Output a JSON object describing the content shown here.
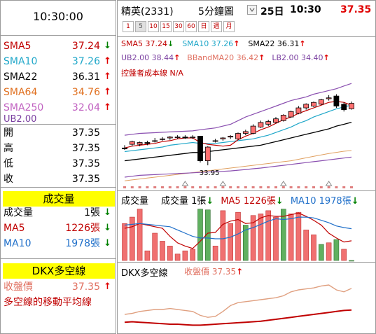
{
  "header": {
    "time": "10:30:00",
    "stock_name": "精英(2331)",
    "interval": "5分鐘圖",
    "date": "25日",
    "clock": "10:30",
    "price": "37.35",
    "timeframes": [
      "1",
      "5",
      "10",
      "15",
      "30",
      "60",
      "日",
      "週",
      "月"
    ],
    "selected_timeframe": "5"
  },
  "sidebar": {
    "ma_rows": [
      {
        "label": "SMA5",
        "value": "37.24",
        "dir": "down",
        "color": "#c00000"
      },
      {
        "label": "SMA10",
        "value": "37.26",
        "dir": "up",
        "color": "#1fa7c9"
      },
      {
        "label": "SMA22",
        "value": "36.31",
        "dir": "up",
        "color": "#000000"
      },
      {
        "label": "SMA64",
        "value": "34.76",
        "dir": "up",
        "color": "#e07020"
      },
      {
        "label": "SMA250",
        "value": "32.04",
        "dir": "up",
        "color": "#c060c0"
      }
    ],
    "ub_label": "UB2.00",
    "quote_rows": [
      {
        "label": "開",
        "value": "37.35"
      },
      {
        "label": "高",
        "value": "37.35"
      },
      {
        "label": "低",
        "value": "37.35"
      },
      {
        "label": "收",
        "value": "37.35"
      }
    ],
    "volume_title": "成交量",
    "volume_rows": [
      {
        "label": "成交量",
        "value": "1張",
        "dir": "down",
        "color": "#000000"
      },
      {
        "label": "MA5",
        "value": "1226張",
        "dir": "down",
        "color": "#c00000"
      },
      {
        "label": "MA10",
        "value": "1978張",
        "dir": "down",
        "color": "#1f6fc9"
      }
    ],
    "dkx_title": "DKX多空線",
    "dkx_rows": [
      {
        "label": "收盤價",
        "value": "37.35",
        "dir": "up",
        "color": "#e07060"
      },
      {
        "label": "多空線的移動平均線",
        "value": "",
        "dir": "",
        "color": "#c00000"
      }
    ]
  },
  "main_chart": {
    "legend_line1": [
      {
        "text": "SMA5 37.24",
        "dir": "down",
        "color": "#c00000"
      },
      {
        "text": "SMA10 37.26",
        "dir": "up",
        "color": "#1fa7c9"
      },
      {
        "text": "SMA22 36.31",
        "dir": "up",
        "color": "#000000"
      }
    ],
    "legend_line2": [
      {
        "text": "UB2.00 38.44",
        "dir": "up",
        "color": "#7a3fa0"
      },
      {
        "text": "BBandMA20 36.42",
        "dir": "up",
        "color": "#e07060"
      },
      {
        "text": "LB2.00 34.40",
        "dir": "up",
        "color": "#7a3fa0"
      }
    ],
    "cost_line": "控盤者成本線 N/A",
    "low_marker": "33.95"
  },
  "volume_panel": {
    "title": "成交量",
    "legend": [
      {
        "text": "成交量 1張",
        "dir": "down",
        "color": "#000000"
      },
      {
        "text": "MA5 1226張",
        "dir": "down",
        "color": "#c00000"
      },
      {
        "text": "MA10 1978張",
        "dir": "down",
        "color": "#1f6fc9"
      }
    ]
  },
  "dkx_panel": {
    "title": "DKX多空線",
    "legend": [
      {
        "text": "收盤價 37.35",
        "dir": "up",
        "color": "#e07060"
      }
    ]
  },
  "chart_data": {
    "type": "candlestick",
    "candles": [
      {
        "o": 34.9,
        "h": 35.05,
        "l": 34.8,
        "c": 34.85
      },
      {
        "o": 35.1,
        "h": 35.3,
        "l": 35.0,
        "c": 35.25
      },
      {
        "o": 35.1,
        "h": 35.25,
        "l": 35.0,
        "c": 35.2
      },
      {
        "o": 35.2,
        "h": 35.3,
        "l": 35.05,
        "c": 35.15
      },
      {
        "o": 35.3,
        "h": 35.45,
        "l": 35.2,
        "c": 35.3
      },
      {
        "o": 35.4,
        "h": 35.5,
        "l": 35.3,
        "c": 35.4
      },
      {
        "o": 35.45,
        "h": 35.55,
        "l": 35.35,
        "c": 35.5
      },
      {
        "o": 35.5,
        "h": 35.6,
        "l": 35.4,
        "c": 35.5
      },
      {
        "o": 35.5,
        "h": 35.6,
        "l": 35.4,
        "c": 35.45
      },
      {
        "o": 35.5,
        "h": 35.6,
        "l": 35.4,
        "c": 35.5
      },
      {
        "o": 35.55,
        "h": 35.55,
        "l": 34.1,
        "c": 34.2
      },
      {
        "o": 34.2,
        "h": 35.0,
        "l": 33.95,
        "c": 34.95
      },
      {
        "o": 35.3,
        "h": 35.4,
        "l": 35.2,
        "c": 35.3
      },
      {
        "o": 35.4,
        "h": 35.5,
        "l": 35.3,
        "c": 35.45
      },
      {
        "o": 35.5,
        "h": 35.6,
        "l": 35.4,
        "c": 35.55
      },
      {
        "o": 35.4,
        "h": 35.75,
        "l": 35.35,
        "c": 35.7
      },
      {
        "o": 35.7,
        "h": 35.9,
        "l": 35.6,
        "c": 35.8
      },
      {
        "o": 35.7,
        "h": 36.2,
        "l": 35.65,
        "c": 36.1
      },
      {
        "o": 36.05,
        "h": 36.4,
        "l": 36.0,
        "c": 36.3
      },
      {
        "o": 36.2,
        "h": 36.45,
        "l": 36.1,
        "c": 36.35
      },
      {
        "o": 36.3,
        "h": 36.6,
        "l": 36.25,
        "c": 36.5
      },
      {
        "o": 36.4,
        "h": 36.75,
        "l": 36.35,
        "c": 36.7
      },
      {
        "o": 36.6,
        "h": 36.95,
        "l": 36.55,
        "c": 36.9
      },
      {
        "o": 36.8,
        "h": 37.2,
        "l": 36.75,
        "c": 37.1
      },
      {
        "o": 37.1,
        "h": 37.35,
        "l": 37.0,
        "c": 37.3
      },
      {
        "o": 37.2,
        "h": 37.45,
        "l": 37.15,
        "c": 37.4
      },
      {
        "o": 37.3,
        "h": 37.6,
        "l": 37.25,
        "c": 37.55
      },
      {
        "o": 37.6,
        "h": 37.8,
        "l": 37.5,
        "c": 37.65
      },
      {
        "o": 37.75,
        "h": 37.85,
        "l": 37.1,
        "c": 37.2
      },
      {
        "o": 37.3,
        "h": 37.4,
        "l": 36.9,
        "c": 37.0
      },
      {
        "o": 37.05,
        "h": 37.45,
        "l": 37.0,
        "c": 37.35
      }
    ],
    "ma5": [
      34.9,
      35.0,
      35.05,
      35.1,
      35.15,
      35.25,
      35.3,
      35.4,
      35.45,
      35.45,
      35.2,
      35.1,
      35.05,
      35.0,
      35.05,
      35.35,
      35.55,
      35.7,
      35.9,
      36.05,
      36.25,
      36.45,
      36.6,
      36.8,
      36.95,
      37.1,
      37.25,
      37.4,
      37.45,
      37.4,
      37.24
    ],
    "ma10": [
      34.7,
      34.75,
      34.8,
      34.85,
      34.9,
      34.95,
      35.05,
      35.1,
      35.15,
      35.2,
      35.15,
      35.15,
      35.15,
      35.2,
      35.25,
      35.3,
      35.35,
      35.4,
      35.5,
      35.6,
      35.75,
      35.9,
      36.05,
      36.25,
      36.4,
      36.6,
      36.75,
      36.9,
      37.05,
      37.15,
      37.26
    ],
    "ma22": [
      34.2,
      34.25,
      34.3,
      34.35,
      34.4,
      34.45,
      34.5,
      34.55,
      34.6,
      34.65,
      34.65,
      34.7,
      34.75,
      34.8,
      34.85,
      34.9,
      34.95,
      35.0,
      35.05,
      35.15,
      35.25,
      35.35,
      35.45,
      35.55,
      35.65,
      35.75,
      35.85,
      35.95,
      36.1,
      36.2,
      36.31
    ],
    "ub": [
      35.6,
      35.65,
      35.7,
      35.72,
      35.74,
      35.76,
      35.78,
      35.8,
      35.82,
      35.84,
      35.9,
      35.95,
      36.0,
      36.1,
      36.2,
      36.4,
      36.6,
      36.75,
      36.9,
      37.05,
      37.2,
      37.35,
      37.5,
      37.6,
      37.7,
      37.85,
      37.95,
      38.05,
      38.15,
      38.3,
      38.44
    ],
    "lb": [
      33.3,
      33.35,
      33.4,
      33.42,
      33.44,
      33.46,
      33.48,
      33.5,
      33.52,
      33.54,
      33.56,
      33.58,
      33.6,
      33.62,
      33.64,
      33.68,
      33.72,
      33.76,
      33.8,
      33.85,
      33.9,
      33.95,
      34.0,
      34.05,
      34.1,
      34.15,
      34.2,
      34.25,
      34.3,
      34.35,
      34.4
    ],
    "ma64": [
      33.1,
      33.15,
      33.2,
      33.25,
      33.3,
      33.35,
      33.4,
      33.45,
      33.5,
      33.55,
      33.6,
      33.65,
      33.7,
      33.75,
      33.8,
      33.85,
      33.9,
      33.95,
      34.0,
      34.05,
      34.1,
      34.15,
      34.2,
      34.28,
      34.36,
      34.44,
      34.52,
      34.6,
      34.66,
      34.72,
      34.76
    ],
    "ylim": [
      33.3,
      38.6
    ],
    "volume": [
      0,
      0,
      0,
      0,
      0,
      0,
      0,
      0,
      0,
      0,
      0,
      0,
      0,
      0,
      0,
      0,
      0,
      0,
      0,
      0,
      2600,
      1900,
      2500,
      2400,
      2300,
      2200,
      2000,
      2100,
      1400,
      800,
      1
    ],
    "volume_full": [
      0,
      0,
      0,
      0,
      0,
      0,
      0,
      0,
      0,
      0,
      0,
      0,
      0,
      0,
      0,
      0,
      0,
      0,
      0,
      0,
      0,
      0,
      0,
      0,
      0,
      0,
      0,
      0,
      0,
      0,
      0
    ],
    "vol_bars": [
      {
        "v": 2300,
        "up": true
      },
      {
        "v": 2700,
        "up": true
      },
      {
        "v": 3200,
        "up": true
      },
      {
        "v": 600,
        "up": true
      },
      {
        "v": 1700,
        "up": true
      },
      {
        "v": 1200,
        "up": true
      },
      {
        "v": 900,
        "up": true
      },
      {
        "v": 400,
        "up": true
      },
      {
        "v": 600,
        "up": true
      },
      {
        "v": 700,
        "up": true
      },
      {
        "v": 3200,
        "up": false
      },
      {
        "v": 3150,
        "up": false
      },
      {
        "v": 900,
        "up": true
      },
      {
        "v": 3100,
        "up": true
      },
      {
        "v": 2300,
        "up": true
      },
      {
        "v": 3000,
        "up": true
      },
      {
        "v": 2200,
        "up": false
      },
      {
        "v": 2800,
        "up": true
      },
      {
        "v": 2900,
        "up": true
      },
      {
        "v": 3100,
        "up": true
      },
      {
        "v": 2700,
        "up": true
      },
      {
        "v": 3200,
        "up": false
      },
      {
        "v": 2900,
        "up": true
      },
      {
        "v": 3000,
        "up": true
      },
      {
        "v": 1900,
        "up": true
      },
      {
        "v": 1600,
        "up": true
      },
      {
        "v": 1000,
        "up": false
      },
      {
        "v": 1100,
        "up": true
      },
      {
        "v": 1300,
        "up": false
      },
      {
        "v": 700,
        "up": true
      },
      {
        "v": 1,
        "up": false
      }
    ],
    "vol_ma5": [
      2000,
      2100,
      2300,
      2200,
      2100,
      2000,
      1500,
      1100,
      900,
      750,
      1200,
      1700,
      1750,
      2250,
      2450,
      2550,
      2300,
      2350,
      2650,
      2800,
      2750,
      2750,
      2850,
      2950,
      2750,
      2500,
      2200,
      1700,
      1400,
      1150,
      1226
    ],
    "vol_ma10": [
      2200,
      2250,
      2300,
      2250,
      2200,
      2150,
      2100,
      1900,
      1700,
      1500,
      1400,
      1400,
      1350,
      1350,
      1450,
      1650,
      1900,
      2050,
      2250,
      2450,
      2600,
      2550,
      2600,
      2700,
      2700,
      2650,
      2500,
      2350,
      2150,
      2050,
      1978
    ],
    "vol_ylim": [
      0,
      3400
    ],
    "dkx": [
      33.9,
      33.95,
      33.9,
      33.85,
      33.8,
      33.75,
      33.7,
      33.7,
      33.65,
      33.6,
      33.6,
      33.65,
      33.7,
      33.75,
      33.8,
      33.85,
      33.9,
      33.95,
      34.0,
      34.1,
      34.2,
      34.3,
      34.4,
      34.5,
      34.6,
      34.7,
      34.8,
      34.9,
      35.0,
      35.1,
      35.15
    ],
    "close_line": [
      34.7,
      34.8,
      35.0,
      35.1,
      35.2,
      35.2,
      35.3,
      35.2,
      35.1,
      35.0,
      34.6,
      34.4,
      34.5,
      35.0,
      35.6,
      35.9,
      36.0,
      36.1,
      36.2,
      36.3,
      36.4,
      36.6,
      37.0,
      37.2,
      37.3,
      37.4,
      37.6,
      37.7,
      37.2,
      37.0,
      37.35
    ],
    "dkx_ylim": [
      33.2,
      38.2
    ]
  }
}
